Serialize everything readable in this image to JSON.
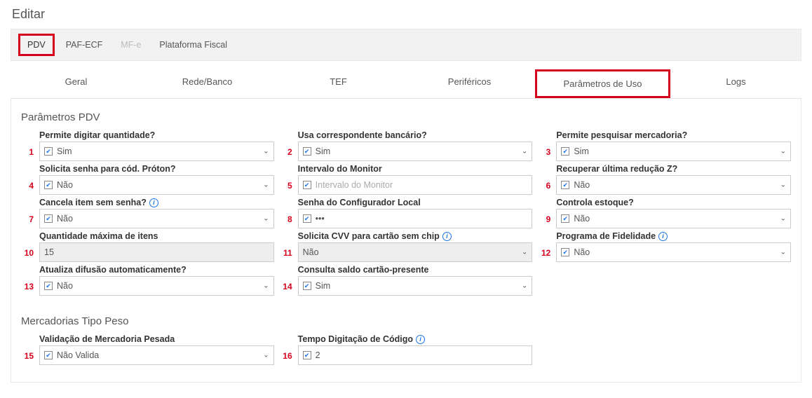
{
  "page_title": "Editar",
  "top_tabs": {
    "pdv": "PDV",
    "paf_ecf": "PAF-ECF",
    "mfe": "MF-e",
    "plataforma_fiscal": "Plataforma Fiscal"
  },
  "sub_tabs": {
    "geral": "Geral",
    "rede_banco": "Rede/Banco",
    "tef": "TEF",
    "perifericos": "Periféricos",
    "parametros_uso": "Parâmetros de Uso",
    "logs": "Logs"
  },
  "sections": {
    "parametros_pdv": "Parâmetros PDV",
    "mercadorias_tipo_peso": "Mercadorias Tipo Peso"
  },
  "numbers": {
    "n1": "1",
    "n2": "2",
    "n3": "3",
    "n4": "4",
    "n5": "5",
    "n6": "6",
    "n7": "7",
    "n8": "8",
    "n9": "9",
    "n10": "10",
    "n11": "11",
    "n12": "12",
    "n13": "13",
    "n14": "14",
    "n15": "15",
    "n16": "16"
  },
  "fields": {
    "permite_digitar_quantidade": {
      "label": "Permite digitar quantidade?",
      "value": "Sim"
    },
    "usa_correspondente_bancario": {
      "label": "Usa correspondente bancário?",
      "value": "Sim"
    },
    "permite_pesquisar_mercadoria": {
      "label": "Permite pesquisar mercadoria?",
      "value": "Sim"
    },
    "solicita_senha_cod_proton": {
      "label": "Solicita senha para cód. Próton?",
      "value": "Não"
    },
    "intervalo_monitor": {
      "label": "Intervalo do Monitor",
      "placeholder": "Intervalo do Monitor"
    },
    "recuperar_ultima_reducao_z": {
      "label": "Recuperar última redução Z?",
      "value": "Não"
    },
    "cancela_item_sem_senha": {
      "label": "Cancela item sem senha?",
      "value": "Não"
    },
    "senha_configurador_local": {
      "label": "Senha do Configurador Local",
      "value": "•••"
    },
    "controla_estoque": {
      "label": "Controla estoque?",
      "value": "Não"
    },
    "quantidade_maxima_itens": {
      "label": "Quantidade máxima de itens",
      "value": "15"
    },
    "solicita_cvv_sem_chip": {
      "label": "Solicita CVV para cartão sem chip",
      "value": "Não"
    },
    "programa_fidelidade": {
      "label": "Programa de Fidelidade",
      "value": "Não"
    },
    "atualiza_difusao_automaticamente": {
      "label": "Atualiza difusão automaticamente?",
      "value": "Não"
    },
    "consulta_saldo_cartao_presente": {
      "label": "Consulta saldo cartão-presente",
      "value": "Sim"
    },
    "validacao_mercadoria_pesada": {
      "label": "Validação de Mercadoria Pesada",
      "value": "Não Valida"
    },
    "tempo_digitacao_codigo": {
      "label": "Tempo Digitação de Código",
      "value": "2"
    }
  }
}
